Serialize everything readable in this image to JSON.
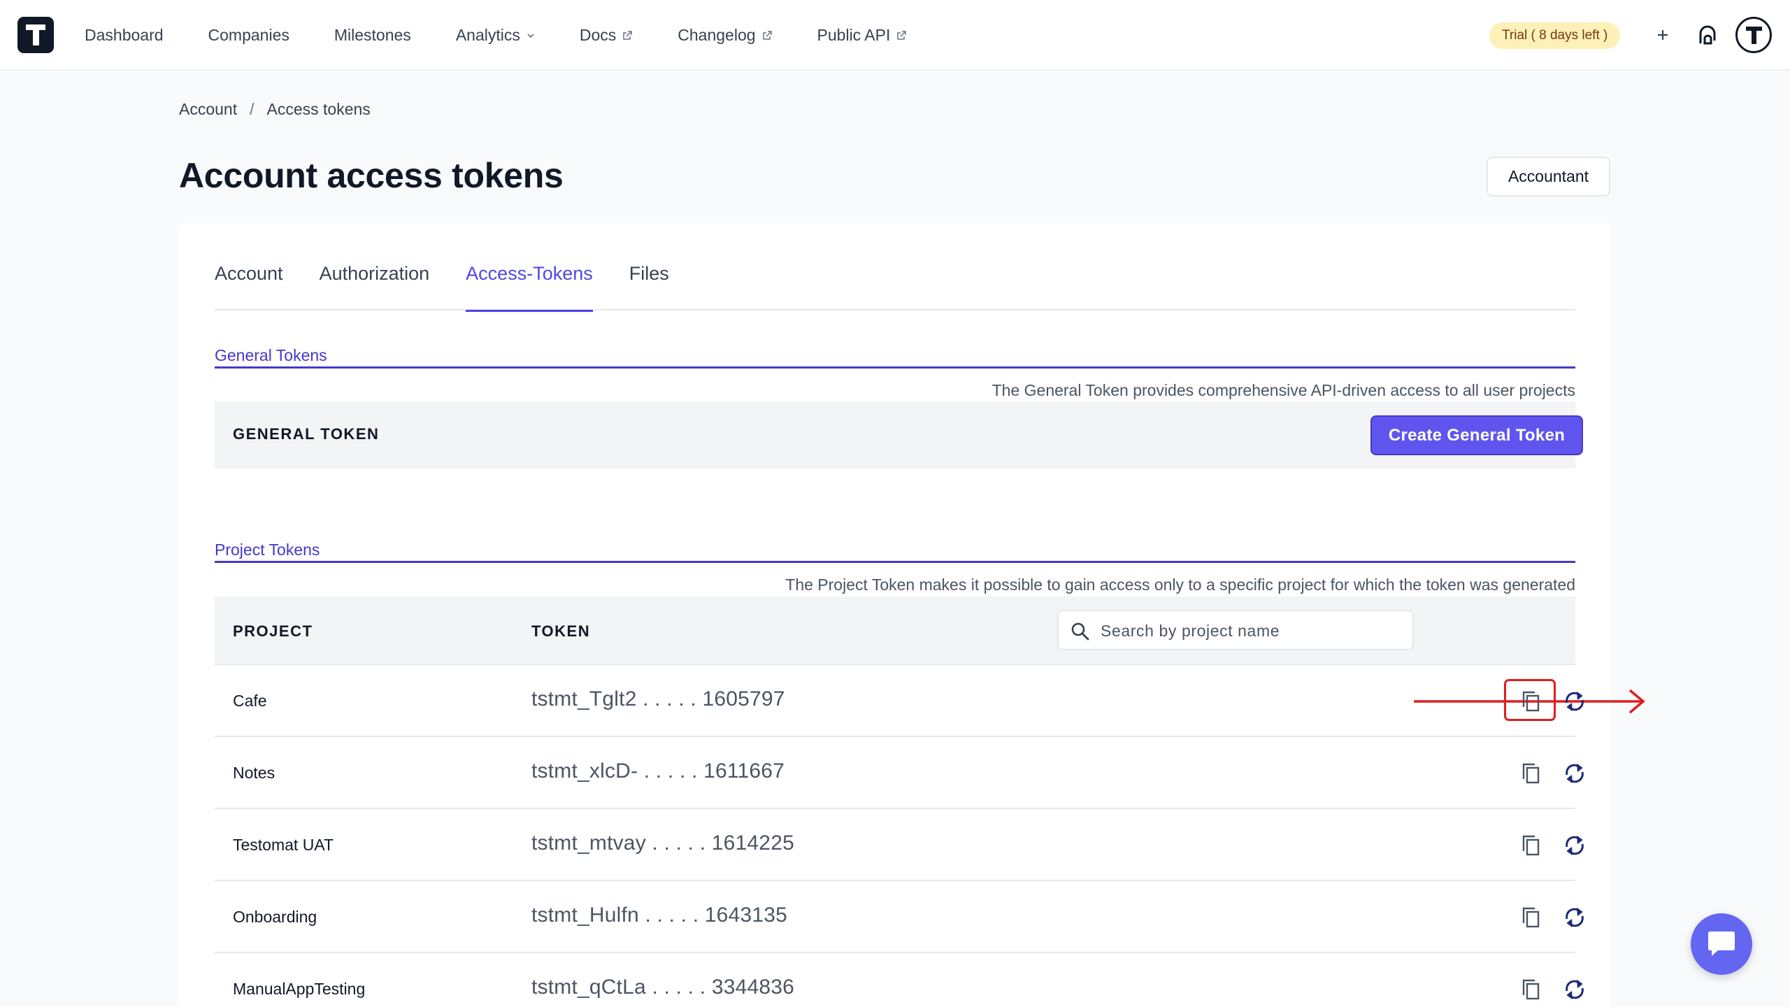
{
  "nav": {
    "links": [
      "Dashboard",
      "Companies",
      "Milestones",
      "Analytics",
      "Docs",
      "Changelog",
      "Public API"
    ],
    "trial_badge": "Trial ( 8 days left )",
    "plus_label": "+"
  },
  "breadcrumb": {
    "root": "Account",
    "separator": "/",
    "current": "Access tokens"
  },
  "page": {
    "title": "Account access tokens",
    "accountant_label": "Accountant"
  },
  "tabs": [
    {
      "label": "Account",
      "active": false
    },
    {
      "label": "Authorization",
      "active": false
    },
    {
      "label": "Access-Tokens",
      "active": true
    },
    {
      "label": "Files",
      "active": false
    }
  ],
  "general": {
    "heading": "General Tokens",
    "description": "The General Token provides comprehensive API-driven access to all user projects",
    "row_label": "GENERAL TOKEN",
    "create_label": "Create General Token"
  },
  "project": {
    "heading": "Project Tokens",
    "description": "The Project Token makes it possible to gain access only to a specific project for which the token was generated",
    "col_project": "PROJECT",
    "col_token": "TOKEN",
    "search_placeholder": "Search by project name",
    "rows": [
      {
        "project": "Cafe",
        "token": "tstmt_Tglt2 . . . . . 1605797"
      },
      {
        "project": "Notes",
        "token": "tstmt_xlcD- . . . . . 1611667"
      },
      {
        "project": "Testomat UAT",
        "token": "tstmt_mtvay . . . . . 1614225"
      },
      {
        "project": "Onboarding",
        "token": "tstmt_Hulfn . . . . . 1643135"
      },
      {
        "project": "ManualAppTesting",
        "token": "tstmt_qCtLa . . . . . 3344836"
      }
    ]
  },
  "colors": {
    "accent": "#4f46e5",
    "button": "#5f55ee",
    "highlight": "#e11d1d",
    "trial_bg": "#fdf1b8"
  },
  "icons": [
    "logo",
    "external-link-icon",
    "chevron-down-icon",
    "plus-icon",
    "notification-icon",
    "avatar",
    "search-icon",
    "copy-icon",
    "refresh-icon",
    "chat-icon",
    "arrow-right-annotation"
  ]
}
